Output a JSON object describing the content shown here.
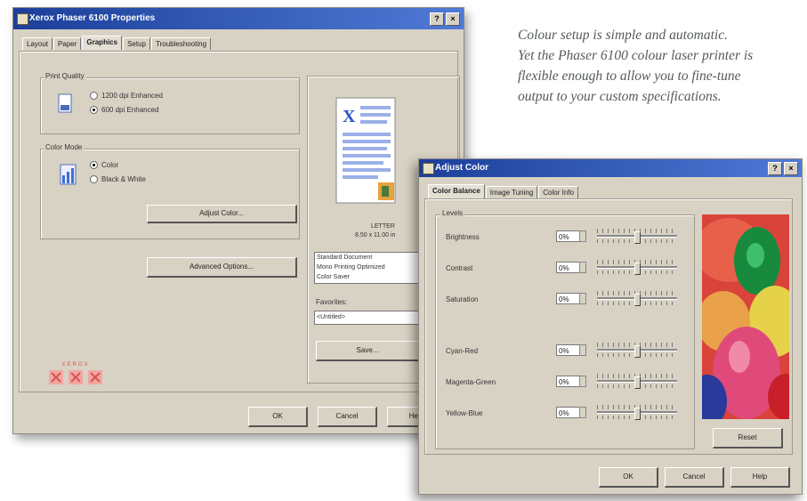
{
  "caption": {
    "line1": "Colour setup is simple and automatic.",
    "line2": "Yet the Phaser 6100 colour laser printer is",
    "line3": "flexible enough to allow you to fine-tune",
    "line4": "output to your custom specifications."
  },
  "props": {
    "title": "Xerox Phaser 6100 Properties",
    "tabs": [
      "Layout",
      "Paper",
      "Graphics",
      "Setup",
      "Troubleshooting"
    ],
    "active_tab": "Graphics",
    "print_quality": {
      "label": "Print Quality",
      "options": [
        "1200 dpi Enhanced",
        "600 dpi Enhanced"
      ],
      "selected": "600 dpi Enhanced"
    },
    "color_mode": {
      "label": "Color Mode",
      "options": [
        "Color",
        "Black & White"
      ],
      "selected": "Color"
    },
    "adjust_color_button": "Adjust Color...",
    "advanced_button": "Advanced Options...",
    "paper_info": "LETTER",
    "paper_size": "8.50 x 11.00 in",
    "settings_list": [
      "Standard Document",
      "Mono Printing Optimized",
      "Color Saver"
    ],
    "favorites_label": "Favorites:",
    "favorites_value": "<Untitled>",
    "save_button": "Save...",
    "ok": "OK",
    "cancel": "Cancel",
    "help": "Help",
    "brand": "XEROX",
    "colors": {
      "titlebar": "#1b3f9a",
      "face": "#d8d2c4",
      "brand_red": "#d9534f"
    }
  },
  "adjust": {
    "title": "Adjust Color",
    "tabs": [
      "Color Balance",
      "Image Tuning",
      "Color Info"
    ],
    "active_tab": "Color Balance",
    "group_label": "Levels",
    "sliders": [
      {
        "label": "Brightness",
        "value": "0%",
        "position": 0.5
      },
      {
        "label": "Contrast",
        "value": "0%",
        "position": 0.5
      },
      {
        "label": "Saturation",
        "value": "0%",
        "position": 0.5
      },
      {
        "label": "Cyan-Red",
        "value": "0%",
        "position": 0.5
      },
      {
        "label": "Magenta-Green",
        "value": "0%",
        "position": 0.5
      },
      {
        "label": "Yellow-Blue",
        "value": "0%",
        "position": 0.5
      }
    ],
    "reset_button": "Reset",
    "ok": "OK",
    "cancel": "Cancel",
    "help": "Help"
  }
}
